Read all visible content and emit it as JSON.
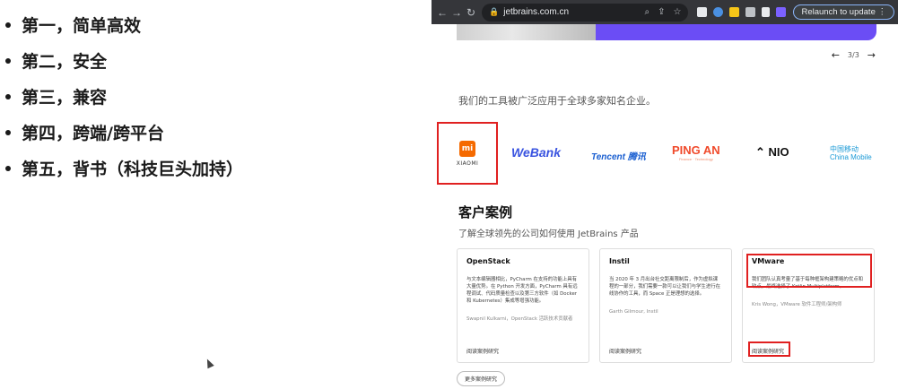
{
  "slide": {
    "bullets": [
      "第一，简单高效",
      "第二，安全",
      "第三，兼容",
      "第四，跨端/跨平台",
      "第五，背书（科技巨头加持）"
    ]
  },
  "browser": {
    "url": "jetbrains.com.cn",
    "relaunch_label": "Relaunch to update",
    "pager_text": "3/3",
    "trust_text": "我们的工具被广泛应用于全球多家知名企业。",
    "logos": {
      "xiaomi_mark": "mi",
      "xiaomi": "XIAOMI",
      "webank": "WeBank",
      "tencent": "Tencent 腾讯",
      "pingan": "PING AN",
      "pingan_sub": "Finance · Technology",
      "nio": "NIO",
      "cmobile_cn": "中国移动",
      "cmobile_en": "China Mobile"
    },
    "section_title": "客户案例",
    "section_subtitle": "了解全球领先的公司如何使用 JetBrains 产品",
    "cards": [
      {
        "title": "OpenStack",
        "body": "与文本编辑器相比，PyCharm 在支持的功能上具有大量优势。在 Python 开发方面，PyCharm 具有远程调试、代码质量检查以及第三方软件（如 Docker 和 Kubernetes）集成等增强功能。",
        "author": "Swapnil Kulkarni，OpenStack 活跃技术贡献者",
        "read_more": "阅读案例研究"
      },
      {
        "title": "Instil",
        "body": "当 2020 年 3 月出台社交距离限制后，作为虚拟课程的一部分，我们需要一款可以让我们与学生进行在线协作的工具，而 Space 正是理想的选择。",
        "author": "Garth Gilmour, Instil",
        "read_more": "阅读案例研究"
      },
      {
        "title": "VMware",
        "body": "我们团队认真考量了基于每种框架构建策略的优点和缺点，最终选择了 Kotlin Multiplatform。",
        "author": "Kris Wong，VMware 软件工程师/架构师",
        "read_more": "阅读案例研究"
      }
    ],
    "more_button": "更多案例研究"
  },
  "colors": {
    "accent_purple": "#6b4df5",
    "highlight_red": "#e02020",
    "chrome_dark": "#35363a"
  }
}
